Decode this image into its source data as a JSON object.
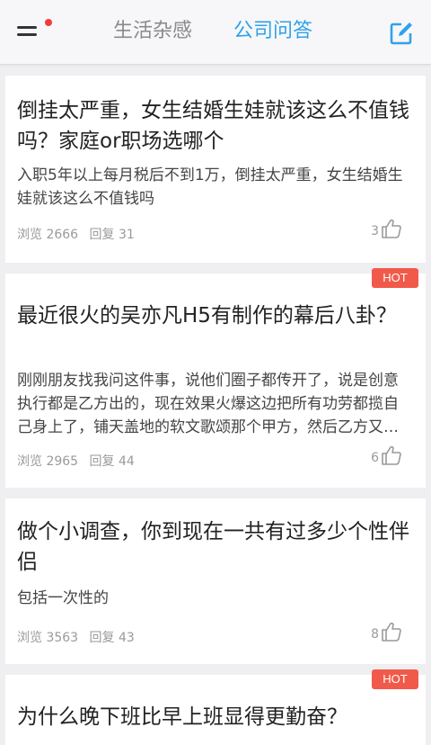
{
  "header": {
    "tab_life": "生活杂感",
    "tab_qa": "公司问答",
    "active_color": "#2fa2ea",
    "notification_color": "#f23b3b"
  },
  "posts": [
    {
      "title": "倒挂太严重，女生结婚生娃就该这么不值钱吗？家庭or职场选哪个",
      "body": "入职5年以上每月税后不到1万，倒挂太严重，女生结婚生娃就该这么不值钱吗",
      "views": "浏览 2666",
      "replies": "回复 31",
      "likes": "3",
      "hot": ""
    },
    {
      "title": "最近很火的吴亦凡H5有制作的幕后八卦？",
      "body": "刚刚朋友找我问这件事，说他们圈子都传开了，说是创意执行都是乙方出的，现在效果火爆这边把所有功劳都揽自己身上了，铺天盖地的软文歌颂那个甲方，然后乙方又不能出来说话，有点替他们觉得冤",
      "views": "浏览 2965",
      "replies": "回复 44",
      "likes": "6",
      "hot": "HOT"
    },
    {
      "title": "做个小调查，你到现在一共有过多少个性伴侣",
      "body": "包括一次性的",
      "views": "浏览 3563",
      "replies": "回复 43",
      "likes": "8",
      "hot": ""
    },
    {
      "title": "为什么晚下班比早上班显得更勤奋？",
      "hot": "HOT"
    }
  ]
}
